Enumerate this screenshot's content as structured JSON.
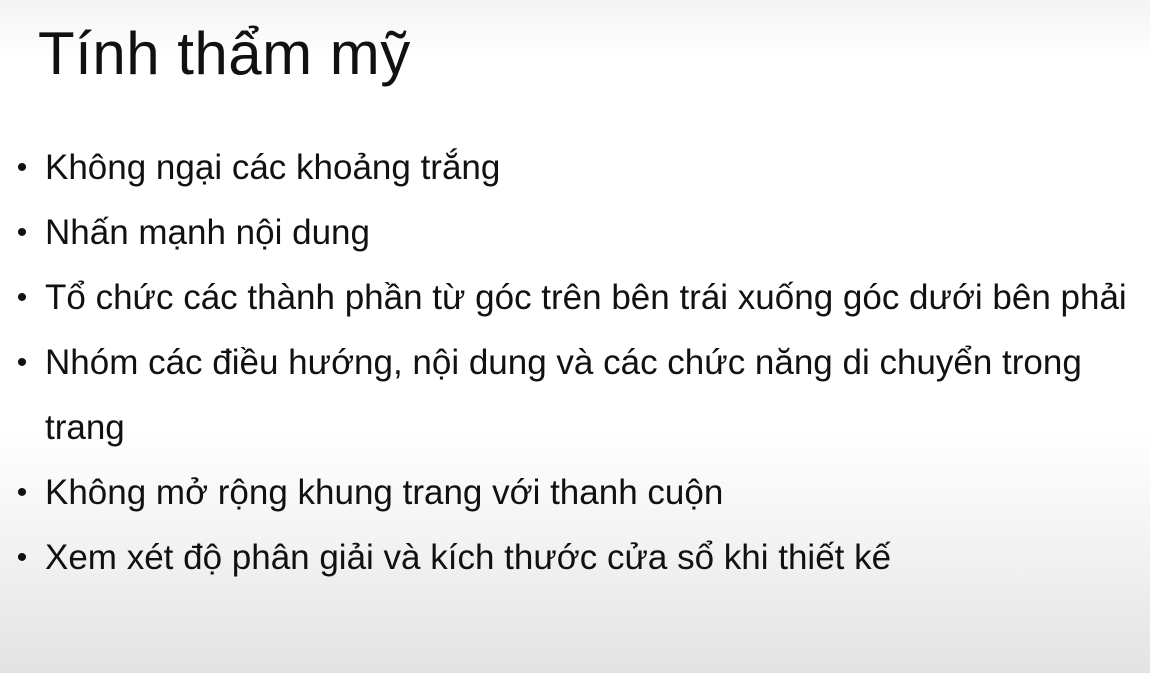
{
  "slide": {
    "title": "Tính thẩm mỹ",
    "bullet_symbol": "•",
    "bullets": [
      {
        "text": "Không ngại các khoảng trắng"
      },
      {
        "text": "Nhấn mạnh nội dung"
      },
      {
        "text": "Tổ chức các thành phần từ góc trên bên trái xuống góc dưới bên phải"
      },
      {
        "text": "Nhóm các điều hướng, nội dung và các chức năng di chuyển trong trang"
      },
      {
        "text": "Không mở rộng khung trang với thanh cuộn"
      },
      {
        "text": "Xem xét độ phân giải và kích thước cửa sổ khi thiết kế"
      }
    ]
  }
}
